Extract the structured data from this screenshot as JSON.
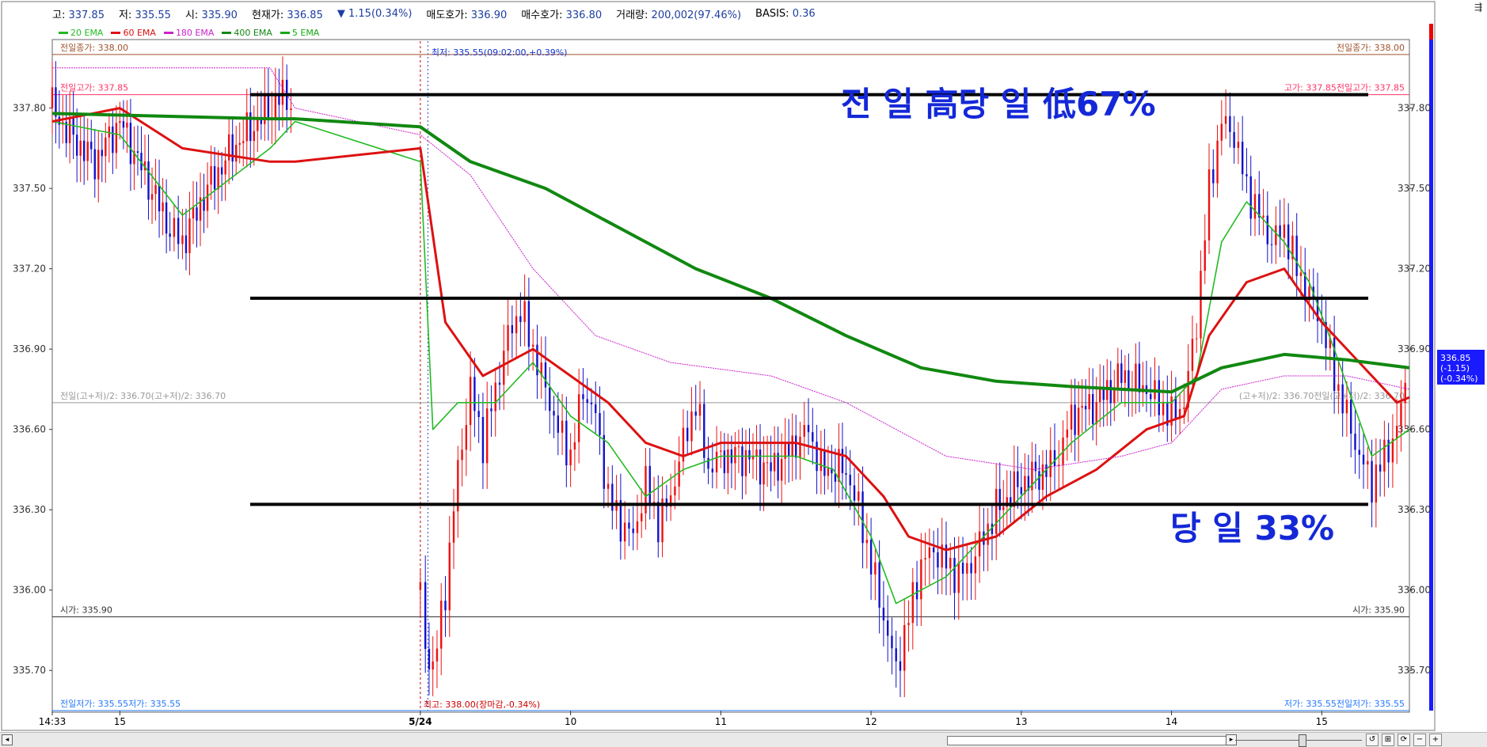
{
  "info": {
    "high_label": "고:",
    "high_value": "337.85",
    "low_label": "저:",
    "low_value": "335.55",
    "open_label": "시:",
    "open_value": "335.90",
    "cur_label": "현재가:",
    "cur_value": "336.85",
    "chg_value": "1.15(0.34%)",
    "ask_label": "매도호가:",
    "ask_value": "336.90",
    "bid_label": "매수호가:",
    "bid_value": "336.80",
    "vol_label": "거래량:",
    "vol_value": "200,002(97.46%)",
    "basis_label": "BASIS:",
    "basis_value": "0.36"
  },
  "legend": [
    {
      "name": "20 EMA",
      "color": "#22bb22"
    },
    {
      "name": "60 EMA",
      "color": "#dd1111"
    },
    {
      "name": "180 EMA",
      "color": "#cc22cc"
    },
    {
      "name": "400 EMA",
      "color": "#118811"
    },
    {
      "name": "5 EMA",
      "color": "#11aa11"
    }
  ],
  "chart_data": {
    "type": "candlestick",
    "ylim": [
      335.55,
      338.05
    ],
    "yticks": [
      "337.80",
      "337.50",
      "337.20",
      "336.90",
      "336.60",
      "336.30",
      "336.00",
      "335.70"
    ],
    "ytick_values": [
      337.8,
      337.5,
      337.2,
      336.9,
      336.6,
      336.3,
      336.0,
      335.7
    ],
    "xtick_labels": [
      "14:33",
      "15",
      "5/24",
      "10",
      "11",
      "12",
      "13",
      "14",
      "15"
    ],
    "xtick_session_minutes": [
      -147,
      -120,
      0,
      60,
      120,
      180,
      240,
      300,
      360
    ],
    "session_start_minute": -147,
    "session_end_minute": 395,
    "horizontal_lines": [
      {
        "label_left": "전일종가: 338.00",
        "label_right": "전일종가: 338.00",
        "value": 338.0,
        "color": "#a0522d"
      },
      {
        "label_left": "전일고가: 337.85",
        "label_right": "고가: 337.85전일고가: 337.85",
        "value": 337.85,
        "color": "#ff3366"
      },
      {
        "label_left": "전일(고+저)/2: 336.70(고+저)/2: 336.70",
        "label_right": "(고+저)/2: 336.70전일(고+저)/2: 336.70",
        "value": 336.7,
        "color": "#999999"
      },
      {
        "label_left": "시가: 335.90",
        "label_right": "시가: 335.90",
        "value": 335.9,
        "color": "#333333"
      },
      {
        "label_left": "전일저가: 335.55저가: 335.55",
        "label_right": "저가: 335.55전일저가: 335.55",
        "value": 335.55,
        "color": "#2277ff"
      }
    ],
    "markers": {
      "low_note": "최저: 335.55(09:02:00,+0.39%)",
      "high_note": "최고: 338.00(장마감,-0.34%)"
    },
    "drawn_levels": [
      337.85,
      337.09,
      336.32
    ],
    "annotations": [
      "전 일 高당 일 低67%",
      "당 일  33%"
    ],
    "current_price_tag": [
      "336.85",
      "(-1.15)",
      "(-0.34%)"
    ],
    "price_path": [
      [
        -147,
        337.8
      ],
      [
        -140,
        337.7
      ],
      [
        -130,
        337.6
      ],
      [
        -120,
        337.75
      ],
      [
        -110,
        337.55
      ],
      [
        -100,
        337.35
      ],
      [
        -95,
        337.3
      ],
      [
        -85,
        337.5
      ],
      [
        -75,
        337.65
      ],
      [
        -65,
        337.75
      ],
      [
        -55,
        337.85
      ],
      [
        -50,
        337.8
      ],
      [
        0,
        336.0
      ],
      [
        2,
        335.8
      ],
      [
        5,
        335.7
      ],
      [
        10,
        336.0
      ],
      [
        15,
        336.45
      ],
      [
        20,
        336.75
      ],
      [
        25,
        336.55
      ],
      [
        30,
        336.75
      ],
      [
        35,
        336.95
      ],
      [
        40,
        337.05
      ],
      [
        45,
        336.9
      ],
      [
        50,
        336.75
      ],
      [
        55,
        336.6
      ],
      [
        60,
        336.5
      ],
      [
        65,
        336.75
      ],
      [
        70,
        336.65
      ],
      [
        75,
        336.35
      ],
      [
        80,
        336.25
      ],
      [
        85,
        336.2
      ],
      [
        90,
        336.4
      ],
      [
        95,
        336.25
      ],
      [
        100,
        336.35
      ],
      [
        105,
        336.55
      ],
      [
        110,
        336.7
      ],
      [
        115,
        336.45
      ],
      [
        120,
        336.5
      ],
      [
        130,
        336.5
      ],
      [
        140,
        336.45
      ],
      [
        150,
        336.55
      ],
      [
        155,
        336.6
      ],
      [
        160,
        336.45
      ],
      [
        170,
        336.45
      ],
      [
        175,
        336.3
      ],
      [
        180,
        336.1
      ],
      [
        185,
        335.9
      ],
      [
        190,
        335.7
      ],
      [
        195,
        335.9
      ],
      [
        200,
        336.1
      ],
      [
        205,
        336.15
      ],
      [
        210,
        336.1
      ],
      [
        215,
        336.05
      ],
      [
        220,
        336.1
      ],
      [
        225,
        336.2
      ],
      [
        230,
        336.3
      ],
      [
        240,
        336.4
      ],
      [
        250,
        336.45
      ],
      [
        255,
        336.5
      ],
      [
        260,
        336.65
      ],
      [
        270,
        336.7
      ],
      [
        280,
        336.8
      ],
      [
        290,
        336.75
      ],
      [
        295,
        336.7
      ],
      [
        300,
        336.65
      ],
      [
        305,
        336.7
      ],
      [
        310,
        337.0
      ],
      [
        315,
        337.5
      ],
      [
        320,
        337.75
      ],
      [
        325,
        337.7
      ],
      [
        330,
        337.5
      ],
      [
        335,
        337.4
      ],
      [
        340,
        337.3
      ],
      [
        345,
        337.35
      ],
      [
        350,
        337.2
      ],
      [
        355,
        337.1
      ],
      [
        360,
        337.0
      ],
      [
        365,
        336.8
      ],
      [
        370,
        336.65
      ],
      [
        375,
        336.5
      ],
      [
        380,
        336.4
      ],
      [
        385,
        336.5
      ],
      [
        390,
        336.6
      ],
      [
        395,
        336.85
      ]
    ],
    "ema": {
      "20 EMA": [
        [
          -147,
          337.75
        ],
        [
          -120,
          337.7
        ],
        [
          -95,
          337.4
        ],
        [
          -60,
          337.65
        ],
        [
          -50,
          337.75
        ],
        [
          0,
          337.6
        ],
        [
          5,
          336.6
        ],
        [
          15,
          336.7
        ],
        [
          30,
          336.7
        ],
        [
          45,
          336.85
        ],
        [
          60,
          336.65
        ],
        [
          75,
          336.55
        ],
        [
          90,
          336.35
        ],
        [
          105,
          336.45
        ],
        [
          120,
          336.5
        ],
        [
          150,
          336.5
        ],
        [
          165,
          336.45
        ],
        [
          180,
          336.2
        ],
        [
          190,
          335.95
        ],
        [
          200,
          336.0
        ],
        [
          210,
          336.05
        ],
        [
          225,
          336.2
        ],
        [
          240,
          336.35
        ],
        [
          260,
          336.55
        ],
        [
          280,
          336.7
        ],
        [
          300,
          336.7
        ],
        [
          310,
          336.8
        ],
        [
          320,
          337.3
        ],
        [
          330,
          337.45
        ],
        [
          345,
          337.3
        ],
        [
          355,
          337.15
        ],
        [
          365,
          336.9
        ],
        [
          380,
          336.5
        ],
        [
          395,
          336.6
        ]
      ],
      "60 EMA": [
        [
          -147,
          337.75
        ],
        [
          -120,
          337.8
        ],
        [
          -95,
          337.65
        ],
        [
          -60,
          337.6
        ],
        [
          -50,
          337.6
        ],
        [
          0,
          337.65
        ],
        [
          10,
          337.0
        ],
        [
          25,
          336.8
        ],
        [
          45,
          336.9
        ],
        [
          60,
          336.8
        ],
        [
          75,
          336.7
        ],
        [
          90,
          336.55
        ],
        [
          105,
          336.5
        ],
        [
          120,
          336.55
        ],
        [
          150,
          336.55
        ],
        [
          170,
          336.5
        ],
        [
          185,
          336.35
        ],
        [
          195,
          336.2
        ],
        [
          210,
          336.15
        ],
        [
          230,
          336.2
        ],
        [
          250,
          336.35
        ],
        [
          270,
          336.45
        ],
        [
          290,
          336.6
        ],
        [
          305,
          336.65
        ],
        [
          315,
          336.95
        ],
        [
          330,
          337.15
        ],
        [
          345,
          337.2
        ],
        [
          360,
          337.0
        ],
        [
          375,
          336.85
        ],
        [
          390,
          336.7
        ],
        [
          395,
          336.72
        ]
      ],
      "180 EMA": [
        [
          -147,
          337.95
        ],
        [
          -60,
          337.95
        ],
        [
          -50,
          337.8
        ],
        [
          0,
          337.7
        ],
        [
          20,
          337.55
        ],
        [
          45,
          337.2
        ],
        [
          70,
          336.95
        ],
        [
          100,
          336.85
        ],
        [
          140,
          336.8
        ],
        [
          170,
          336.7
        ],
        [
          210,
          336.5
        ],
        [
          245,
          336.45
        ],
        [
          280,
          336.5
        ],
        [
          300,
          336.55
        ],
        [
          320,
          336.75
        ],
        [
          345,
          336.8
        ],
        [
          370,
          336.8
        ],
        [
          395,
          336.75
        ]
      ],
      "400 EMA": [
        [
          -147,
          337.78
        ],
        [
          -60,
          337.76
        ],
        [
          -50,
          337.76
        ],
        [
          0,
          337.73
        ],
        [
          20,
          337.6
        ],
        [
          50,
          337.5
        ],
        [
          80,
          337.35
        ],
        [
          110,
          337.2
        ],
        [
          140,
          337.09
        ],
        [
          170,
          336.95
        ],
        [
          200,
          336.83
        ],
        [
          230,
          336.78
        ],
        [
          260,
          336.76
        ],
        [
          300,
          336.74
        ],
        [
          320,
          336.83
        ],
        [
          345,
          336.88
        ],
        [
          370,
          336.86
        ],
        [
          395,
          336.83
        ]
      ]
    }
  }
}
